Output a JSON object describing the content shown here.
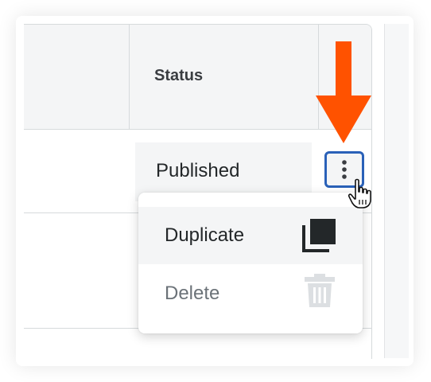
{
  "table": {
    "status_header": "Status",
    "row": {
      "status": "Published"
    }
  },
  "row_actions": {
    "button_icon": "kebab-icon"
  },
  "menu": {
    "items": [
      {
        "label": "Duplicate",
        "icon": "duplicate-icon"
      },
      {
        "label": "Delete",
        "icon": "trash-icon",
        "disabled": true
      }
    ]
  },
  "callout": {
    "icon": "arrow-down-icon",
    "color": "#ff5200"
  },
  "colors": {
    "accent_border": "#2a61b8",
    "header_bg": "#f4f5f6",
    "text_primary": "#232729",
    "text_muted": "#6b7278"
  }
}
